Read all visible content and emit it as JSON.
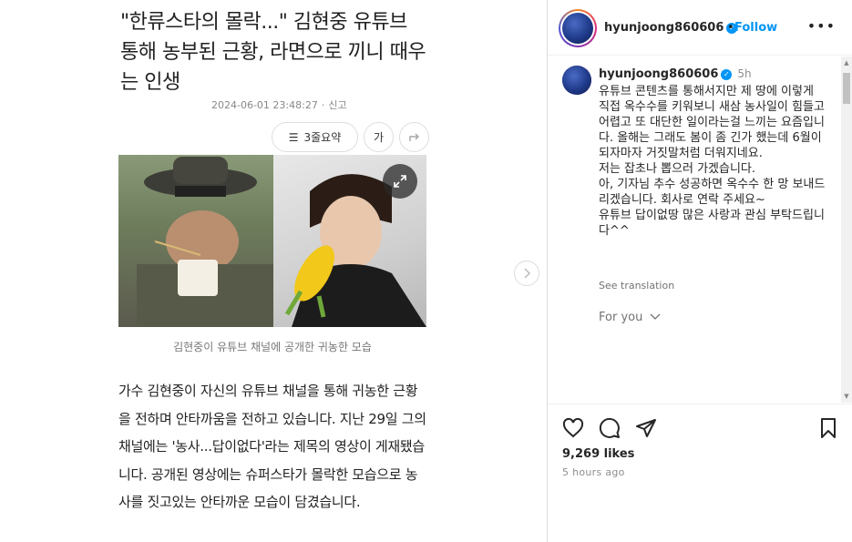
{
  "article": {
    "headline": "\"한류스타의 몰락...\" 김현중 유튜브 통해 농부된 근황, 라면으로 끼니 때우는 인생",
    "date": "2024-06-01 23:48:27",
    "report": "신고",
    "summary_button": "3줄요약",
    "font_button": "가",
    "photo_caption": "김현중이 유튜브 채널에 공개한 귀농한 모습",
    "body": "가수 김현중이 자신의 유튜브 채널을 통해 귀농한 근황을 전하며 안타까움을 전하고 있습니다. 지난 29일 그의 채널에는 '농사...답이없다'라는 제목의 영상이 게재됐습니다. 공개된 영상에는 슈퍼스타가 몰락한 모습으로 농사를 짓고있는 안타까운 모습이 담겼습니다."
  },
  "instagram": {
    "username": "hyunjoong860606",
    "follow_label": "Follow",
    "comment_time": "5h",
    "caption": "유튜브 콘텐츠를 통해서지만 제 땅에 이렇게 직접 옥수수를 키워보니 새삼 농사일이 힘들고 어렵고 또 대단한 일이라는걸 느끼는 요즘입니다. 올해는 그래도 봄이 좀 긴가 했는데 6월이 되자마자 거짓말처럼 더워지네요.\n저는 잡초나 뽑으러 가겠습니다.\n아, 기자님 추수 성공하면 옥수수 한 망 보내드리겠습니다. 회사로 연락 주세요~\n유튜브 답이없땅 많은 사랑과 관심 부탁드립니다^^",
    "see_translation": "See translation",
    "for_you": "For you",
    "likes": "9,269 likes",
    "posted_ago": "5 hours ago"
  }
}
